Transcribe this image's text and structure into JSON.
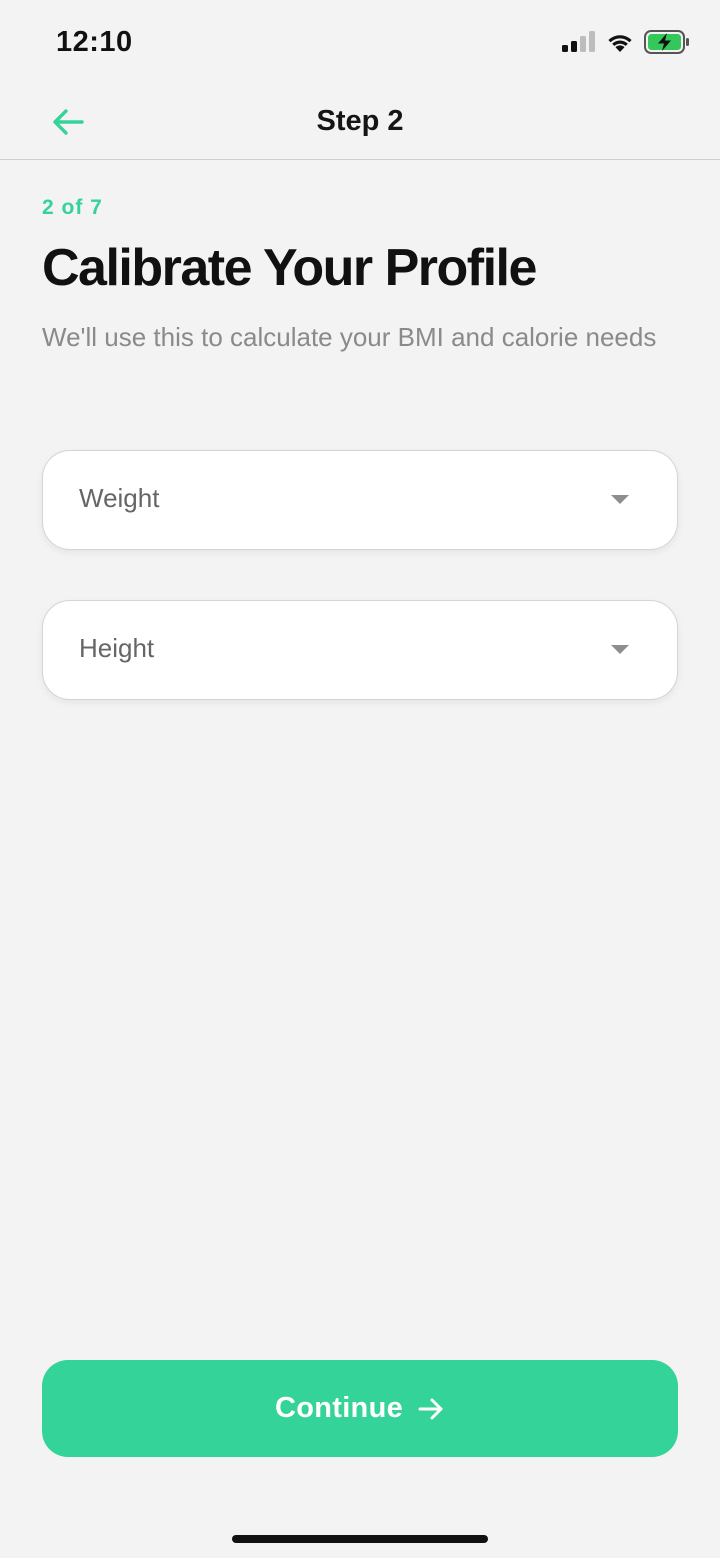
{
  "status_bar": {
    "time": "12:10",
    "icons": [
      "cellular-signal-icon",
      "wifi-icon",
      "battery-charging-icon"
    ]
  },
  "nav": {
    "title": "Step 2",
    "back_icon": "arrow-left-icon"
  },
  "content": {
    "step_count": "2 of 7",
    "title": "Calibrate Your Profile",
    "subtitle": "We'll use this to calculate your BMI and calorie needs"
  },
  "fields": {
    "weight": {
      "label": "Weight",
      "icon": "chevron-down-icon"
    },
    "height": {
      "label": "Height",
      "icon": "chevron-down-icon"
    }
  },
  "footer": {
    "continue_label": "Continue",
    "continue_icon": "arrow-right-icon"
  },
  "colors": {
    "accent": "#34d399",
    "background": "#f3f3f3",
    "text_primary": "#111111",
    "text_secondary": "#8a8a8a",
    "battery": "#34c759"
  }
}
